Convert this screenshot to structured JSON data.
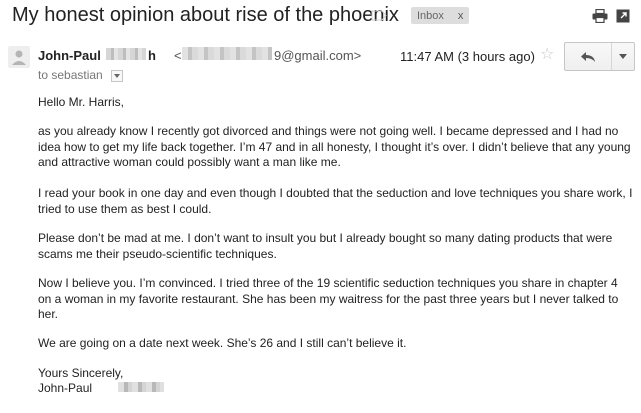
{
  "subject": "My honest opinion about rise of the phoenix",
  "label_chip": {
    "label": "Inbox",
    "remove": "x"
  },
  "sender": {
    "name_first": "John-Paul",
    "name_tail": "h",
    "email_open": "<",
    "email_visible": "9@gmail.com>"
  },
  "recipient": "to sebastian",
  "timestamp": "11:47 AM (3 hours ago)",
  "message": {
    "greeting": "Hello Mr. Harris,",
    "paragraphs": [
      "as you already know I recently got divorced and things were not going well. I became depressed and I had no idea how to get my life back together. I’m 47 and in all honesty, I thought it’s over. I didn’t believe that any young and attractive woman could possibly want a man like me.",
      "I read your book in one day and even though I doubted that the seduction and love techniques you share work, I tried to use them as best I could.",
      "Please don’t be mad at me. I don’t want to insult you but I already bought so many dating products that were scams me their pseudo-scientific techniques.",
      "Now I believe you. I’m convinced. I tried three of the 19 scientific seduction techniques you share in chapter 4 on a woman in my favorite restaurant. She has been my waitress for the past three years but I never talked to her.",
      "We are going on a date next week. She’s 26 and I still can’t believe it."
    ],
    "closing": "Yours Sincerely,",
    "signature": "John-Paul"
  },
  "icons": {
    "importance": "label-arrow-icon",
    "print": "print-icon",
    "new_window": "new-window-icon",
    "star": "star-icon",
    "reply": "reply-arrow-icon",
    "more": "chevron-down-icon"
  },
  "colors": {
    "chip_bg": "#dddddd",
    "text": "#222222",
    "muted": "#777777"
  }
}
